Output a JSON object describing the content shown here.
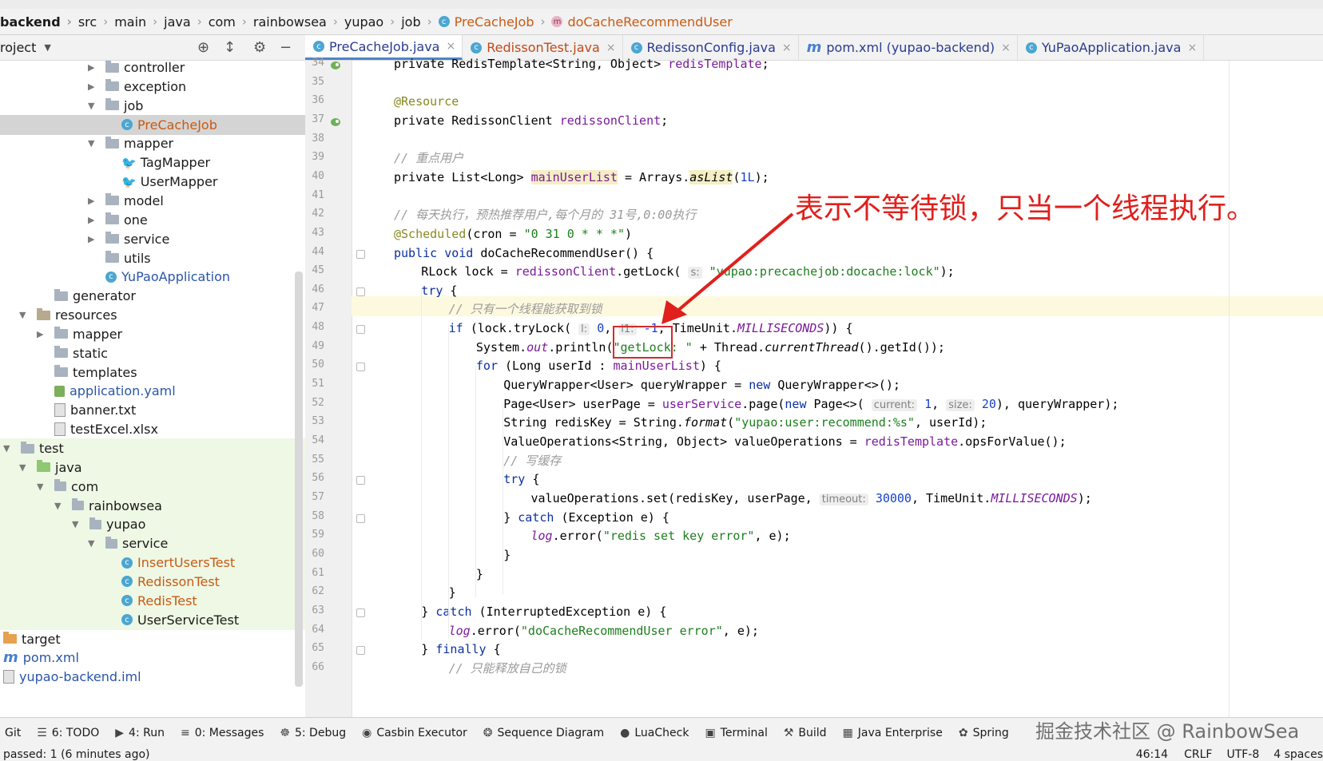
{
  "breadcrumb": [
    "backend",
    "src",
    "main",
    "java",
    "com",
    "rainbowsea",
    "yupao",
    "job",
    "PreCacheJob",
    "doCacheRecommendUser"
  ],
  "project_header": {
    "title": "roject",
    "icons": [
      "target-icon",
      "collapse-icon",
      "gear-icon",
      "minimize-icon"
    ]
  },
  "tabs": [
    {
      "label": "PreCacheJob.java",
      "active": true,
      "modified": false
    },
    {
      "label": "RedissonTest.java",
      "active": false,
      "modified": true
    },
    {
      "label": "RedissonConfig.java",
      "active": false,
      "modified": false
    },
    {
      "label": "pom.xml (yupao-backend)",
      "active": false,
      "modified": false
    },
    {
      "label": "YuPaoApplication.java",
      "active": false,
      "modified": false
    }
  ],
  "tree": [
    {
      "label": "controller",
      "kind": "folder",
      "indent": 132,
      "arrow": "right"
    },
    {
      "label": "exception",
      "kind": "folder",
      "indent": 132,
      "arrow": "right"
    },
    {
      "label": "job",
      "kind": "folder",
      "indent": 132,
      "arrow": "down"
    },
    {
      "label": "PreCacheJob",
      "kind": "class-orange",
      "indent": 152,
      "arrow": "",
      "selected": true
    },
    {
      "label": "mapper",
      "kind": "folder",
      "indent": 132,
      "arrow": "down"
    },
    {
      "label": "TagMapper",
      "kind": "mapper",
      "indent": 152,
      "arrow": ""
    },
    {
      "label": "UserMapper",
      "kind": "mapper",
      "indent": 152,
      "arrow": ""
    },
    {
      "label": "model",
      "kind": "folder",
      "indent": 132,
      "arrow": "right"
    },
    {
      "label": "one",
      "kind": "folder",
      "indent": 132,
      "arrow": "right"
    },
    {
      "label": "service",
      "kind": "folder",
      "indent": 132,
      "arrow": "right"
    },
    {
      "label": "utils",
      "kind": "folder",
      "indent": 132,
      "arrow": ""
    },
    {
      "label": "YuPaoApplication",
      "kind": "class-blue",
      "indent": 132,
      "arrow": ""
    },
    {
      "label": "generator",
      "kind": "folder",
      "indent": 68,
      "arrow": ""
    },
    {
      "label": "resources",
      "kind": "folder-res",
      "indent": 46,
      "arrow": "down"
    },
    {
      "label": "mapper",
      "kind": "folder",
      "indent": 68,
      "arrow": "right"
    },
    {
      "label": "static",
      "kind": "folder",
      "indent": 68,
      "arrow": ""
    },
    {
      "label": "templates",
      "kind": "folder",
      "indent": 68,
      "arrow": ""
    },
    {
      "label": "application.yaml",
      "kind": "yaml",
      "indent": 68,
      "arrow": ""
    },
    {
      "label": "banner.txt",
      "kind": "doc",
      "indent": 68,
      "arrow": ""
    },
    {
      "label": "testExcel.xlsx",
      "kind": "doc",
      "indent": 68,
      "arrow": ""
    },
    {
      "label": "test",
      "kind": "folder",
      "indent": 26,
      "arrow": "down",
      "test": true
    },
    {
      "label": "java",
      "kind": "folder-green",
      "indent": 46,
      "arrow": "down",
      "test": true
    },
    {
      "label": "com",
      "kind": "pkg",
      "indent": 68,
      "arrow": "down",
      "test": true
    },
    {
      "label": "rainbowsea",
      "kind": "pkg",
      "indent": 90,
      "arrow": "down",
      "test": true
    },
    {
      "label": "yupao",
      "kind": "pkg",
      "indent": 112,
      "arrow": "down",
      "test": true
    },
    {
      "label": "service",
      "kind": "pkg",
      "indent": 132,
      "arrow": "down",
      "test": true
    },
    {
      "label": "InsertUsersTest",
      "kind": "class-orange",
      "indent": 152,
      "arrow": "",
      "test": true
    },
    {
      "label": "RedissonTest",
      "kind": "class-orange",
      "indent": 152,
      "arrow": "",
      "test": true
    },
    {
      "label": "RedisTest",
      "kind": "class-orange",
      "indent": 152,
      "arrow": "",
      "test": true
    },
    {
      "label": "UserServiceTest",
      "kind": "class-plain",
      "indent": 152,
      "arrow": "",
      "test": true
    },
    {
      "label": "target",
      "kind": "folder-orange",
      "indent": 4,
      "arrow": ""
    },
    {
      "label": "pom.xml",
      "kind": "pom",
      "indent": 4,
      "arrow": ""
    },
    {
      "label": "yupao-backend.iml",
      "kind": "iml",
      "indent": 4,
      "arrow": ""
    }
  ],
  "code": {
    "line_numbers": [
      "34",
      "35",
      "36",
      "37",
      "38",
      "39",
      "40",
      "41",
      "42",
      "43",
      "44",
      "45",
      "46",
      "47",
      "48",
      "49",
      "50",
      "51",
      "52",
      "53",
      "54",
      "55",
      "56",
      "57",
      "58",
      "59",
      "60",
      "61",
      "62",
      "63",
      "64",
      "65",
      "66"
    ],
    "l34": [
      "private RedisTemplate<String, Object> ",
      "redisTemplate",
      ";"
    ],
    "l36": "@Resource",
    "l37": [
      "private RedissonClient ",
      "redissonClient",
      ";"
    ],
    "l39": "// 重点用户",
    "l40": [
      "private List<Long> ",
      "mainUserList",
      " = Arrays.",
      "asList",
      "(",
      "1L",
      ");"
    ],
    "l42": "// 每天执行，预热推荐用户,每个月的 31号,0:00执行",
    "l43": [
      "@Scheduled",
      "(cron = ",
      "\"0 31 0 * * *\"",
      ")"
    ],
    "l44": [
      "public void ",
      "doCacheRecommendUser",
      "() {"
    ],
    "l45": [
      "RLock lock = ",
      "redissonClient",
      ".getLock( ",
      "s:",
      " ",
      "\"yupao:precachejob:docache:lock\"",
      ");"
    ],
    "l46": [
      "try ",
      "{"
    ],
    "l47": "// 只有一个线程能获取到锁",
    "l48": [
      "if ",
      "(lock.tryLock( ",
      "l:",
      " ",
      "0",
      ", ",
      "l1:",
      " ",
      "-1",
      ", TimeUnit.",
      "MILLISECONDS",
      ")) {"
    ],
    "l49": [
      "System.",
      "out",
      ".println(",
      "\"getLock: \"",
      " + Thread.",
      "currentThread",
      "().getId());"
    ],
    "l50": [
      "for ",
      "(Long userId : ",
      "mainUserList",
      ") {"
    ],
    "l51": [
      "QueryWrapper<User> queryWrapper = ",
      "new ",
      "QueryWrapper<>();"
    ],
    "l52": [
      "Page<User> userPage = ",
      "userService",
      ".page(",
      "new ",
      "Page<>( ",
      "current:",
      " ",
      "1",
      ", ",
      "size:",
      " ",
      "20",
      "), queryWrapper);"
    ],
    "l53": [
      "String redisKey = String.",
      "format",
      "(",
      "\"yupao:user:recommend:%s\"",
      ", userId);"
    ],
    "l54": [
      "ValueOperations<String, Object> valueOperations = ",
      "redisTemplate",
      ".opsForValue();"
    ],
    "l55": "// 写缓存",
    "l56": [
      "try ",
      "{"
    ],
    "l57": [
      "valueOperations.set(redisKey, userPage, ",
      "timeout:",
      " ",
      "30000",
      ", TimeUnit.",
      "MILLISECONDS",
      ");"
    ],
    "l58": [
      "} ",
      "catch ",
      "(Exception e) {"
    ],
    "l59": [
      "log",
      ".error(",
      "\"redis set key error\"",
      ", e);"
    ],
    "l60": "}",
    "l61": "}",
    "l62": "}",
    "l63": [
      "} ",
      "catch ",
      "(InterruptedException e) {"
    ],
    "l64": [
      "log",
      ".error(",
      "\"doCacheRecommendUser error\"",
      ", e);"
    ],
    "l65": [
      "} ",
      "finally ",
      "{"
    ],
    "l66": "// 只能释放自己的锁"
  },
  "annotation": "表示不等待锁，只当一个线程执行。",
  "tool_windows": [
    {
      "label": "Git",
      "icon": ""
    },
    {
      "label": "6: TODO",
      "icon": "list-icon"
    },
    {
      "label": "4: Run",
      "icon": "play-icon"
    },
    {
      "label": "0: Messages",
      "icon": "messages-icon"
    },
    {
      "label": "5: Debug",
      "icon": "bug-icon"
    },
    {
      "label": "Casbin Executor",
      "icon": "casbin-icon"
    },
    {
      "label": "Sequence Diagram",
      "icon": "sequence-icon"
    },
    {
      "label": "LuaCheck",
      "icon": "lua-icon"
    },
    {
      "label": "Terminal",
      "icon": "terminal-icon"
    },
    {
      "label": "Build",
      "icon": "hammer-icon"
    },
    {
      "label": "Java Enterprise",
      "icon": "enterprise-icon"
    },
    {
      "label": "Spring",
      "icon": "spring-icon"
    }
  ],
  "status": {
    "left": "passed: 1 (6 minutes ago)",
    "position": "46:14",
    "line_sep": "CRLF",
    "encoding": "UTF-8",
    "indent": "4 spaces"
  },
  "watermark": "掘金技术社区 @ RainbowSea",
  "colors": {
    "annotation": "#e0201c",
    "keyword": "#0b2fa3",
    "string": "#1e7e1e",
    "comment": "#9a9a9a",
    "field": "#7a1a9b"
  }
}
